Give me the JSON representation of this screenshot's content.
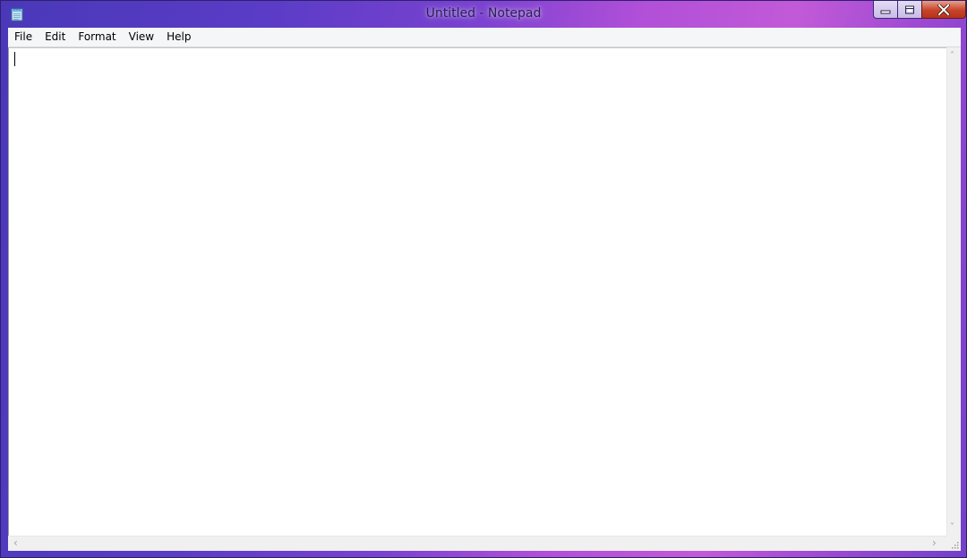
{
  "window": {
    "title": "Untitled - Notepad",
    "app_icon": "notepad-icon",
    "controls": {
      "minimize_icon": "minimize-icon",
      "maximize_icon": "maximize-icon",
      "close_icon": "close-icon"
    }
  },
  "menubar": {
    "items": [
      {
        "label": "File"
      },
      {
        "label": "Edit"
      },
      {
        "label": "Format"
      },
      {
        "label": "View"
      },
      {
        "label": "Help"
      }
    ]
  },
  "editor": {
    "text": ""
  },
  "colors": {
    "titlebar_accent": "#7a42d0",
    "close_button": "#c7432a",
    "menubar_bg": "#f5f6f7"
  }
}
